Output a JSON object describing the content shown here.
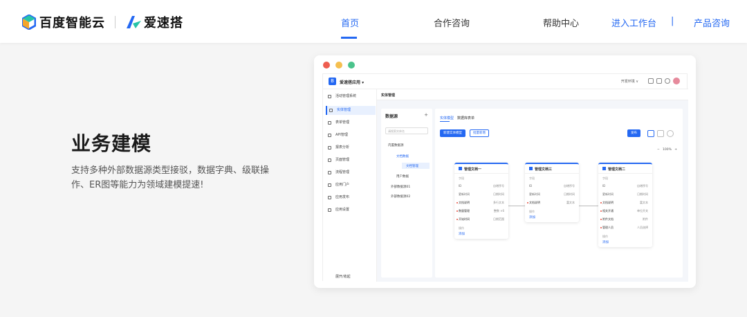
{
  "nav": {
    "brand_name": "百度智能云",
    "product_name": "爱速搭",
    "items": [
      {
        "label": "首页",
        "active": true
      },
      {
        "label": "合作咨询",
        "active": false
      },
      {
        "label": "帮助中心",
        "active": false
      }
    ],
    "workbench": "进入工作台",
    "separator": "|",
    "consult": "产品咨询",
    "accent_color": "#2468f2"
  },
  "hero": {
    "title": "业务建模",
    "description": "支持多种外部数据源类型接驳，数据字典、级联操作、ER图等能力为领域建模提速!"
  },
  "window": {
    "dots": [
      "#ee5d50",
      "#f5bf4f",
      "#4bc38c"
    ]
  },
  "app": {
    "logo_letter": "B",
    "app_name": "爱速搭应用 ▾",
    "env_label": "开发环境 ∨",
    "sidebar": {
      "items": [
        "活动管理系统",
        "实体管理",
        "表单管理",
        "API管理",
        "报表分析",
        "页面管理",
        "流程管理",
        "应用门户",
        "应用发布",
        "应用设置"
      ],
      "active_index": 1,
      "footer": "展开/收起"
    },
    "main_title": "实体管理",
    "datasource": {
      "title": "数据源",
      "add": "+",
      "search_placeholder": "请搜索实体名",
      "tree": [
        "内置数据源",
        "文档数据",
        "文档管理",
        "用户数据",
        "外部数据源01",
        "外部数据源02"
      ]
    },
    "tabs": [
      "实体模型",
      "数据库表单"
    ],
    "buttons": {
      "new_entity": "新建实体模型",
      "import": "批量新增",
      "publish": "发布"
    },
    "zoom": {
      "minus": "−",
      "value": "100%",
      "plus": "+"
    },
    "cards": [
      {
        "title": "管理文档一",
        "fields": [
          {
            "name": "ID",
            "type": "自增序号",
            "required": false
          },
          {
            "name": "更新时间",
            "type": "日期时间",
            "required": false
          },
          {
            "name": "文档说明",
            "type": "多行文本",
            "required": true
          },
          {
            "name": "数量管理",
            "type": "整数 ×6",
            "required": true
          },
          {
            "name": "开始时间",
            "type": "日期范围",
            "required": true
          }
        ],
        "ops": "操作",
        "add": "添加"
      },
      {
        "title": "管理文档三",
        "fields": [
          {
            "name": "ID",
            "type": "自增序号",
            "required": false
          },
          {
            "name": "更新时间",
            "type": "日期时间",
            "required": false
          },
          {
            "name": "文档说明",
            "type": "富文本",
            "required": true
          }
        ],
        "ops": "操作",
        "add": "添加"
      },
      {
        "title": "管理文档二",
        "fields": [
          {
            "name": "ID",
            "type": "自增序号",
            "required": false
          },
          {
            "name": "更新时间",
            "type": "日期时间",
            "required": false
          },
          {
            "name": "文档说明",
            "type": "富文本",
            "required": true
          },
          {
            "name": "相关开通",
            "type": "单位开关",
            "required": true
          },
          {
            "name": "附件文档",
            "type": "附件",
            "required": true
          },
          {
            "name": "管理人员",
            "type": "人员选择",
            "required": true
          }
        ],
        "ops": "操作",
        "add": "添加"
      }
    ]
  }
}
